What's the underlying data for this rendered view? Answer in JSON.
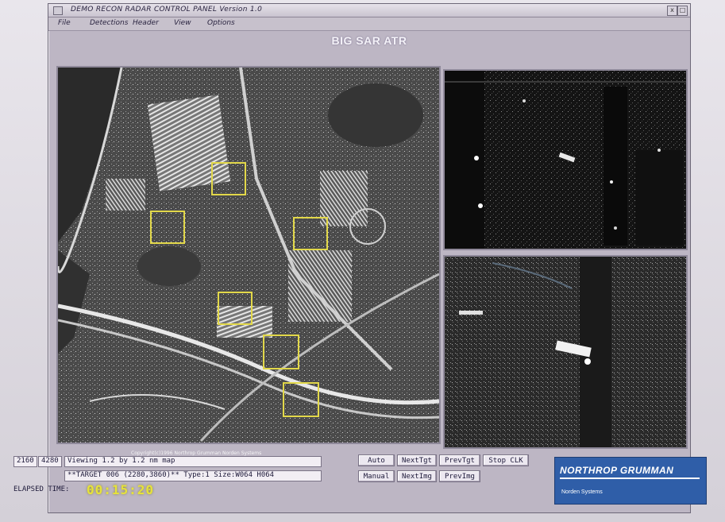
{
  "window": {
    "title": "DEMO RECON RADAR CONTROL PANEL Version 1.0",
    "minimize_glyph": "x",
    "maximize_glyph": "□"
  },
  "menu": {
    "items": [
      "File",
      "Detections",
      "Header",
      "View",
      "Options"
    ]
  },
  "app_title": "BIG SAR ATR",
  "image_panel": {
    "copyright": "Copyright(c)1996 Northrop Grumman Norden Systems",
    "detection_count": 7
  },
  "status": {
    "coord_x": "2160",
    "coord_y": "4280",
    "viewing": "Viewing 1.2 by 1.2 nm map",
    "target": "**TARGET 006 (2280,3860)** Type:1 Size:W064 H064"
  },
  "buttons": {
    "auto": "Auto",
    "next_tgt": "NextTgt",
    "prev_tgt": "PrevTgt",
    "stop_clk": "Stop CLK",
    "manual": "Manual",
    "next_img": "NextImg",
    "prev_img": "PrevImg"
  },
  "elapsed": {
    "label": "ELAPSED TIME:",
    "value": "00:15:20"
  },
  "logo": {
    "main": "NORTHROP GRUMMAN",
    "sub": "Norden Systems"
  },
  "colors": {
    "detection_box": "#e2d84a",
    "elapsed_value": "#e6e23a",
    "logo_bg": "#2f5ea8"
  }
}
